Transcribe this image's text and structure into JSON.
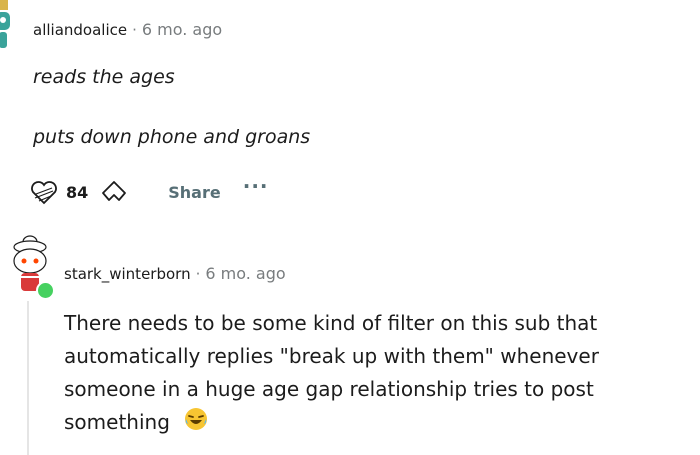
{
  "comment1": {
    "username": "alliandoalice",
    "separator": "·",
    "time": "6 mo. ago",
    "lines": [
      "reads the ages",
      "puts down phone and groans"
    ],
    "vote_count": "84",
    "share_label": "Share",
    "more_label": "···"
  },
  "comment2": {
    "username": "stark_winterborn",
    "separator": "·",
    "time": "6 mo. ago",
    "body": "There needs to be some kind of filter on this sub that automatically replies \"break up with them\" whenever someone in a huge age gap relationship tries to post something",
    "emoji": "laughing-emoji",
    "online_status_color": "#46d160"
  },
  "colors": {
    "text": "#1c1c1c",
    "meta": "#787c7e",
    "action": "#576f76",
    "thread_line": "#e5e5e5"
  }
}
